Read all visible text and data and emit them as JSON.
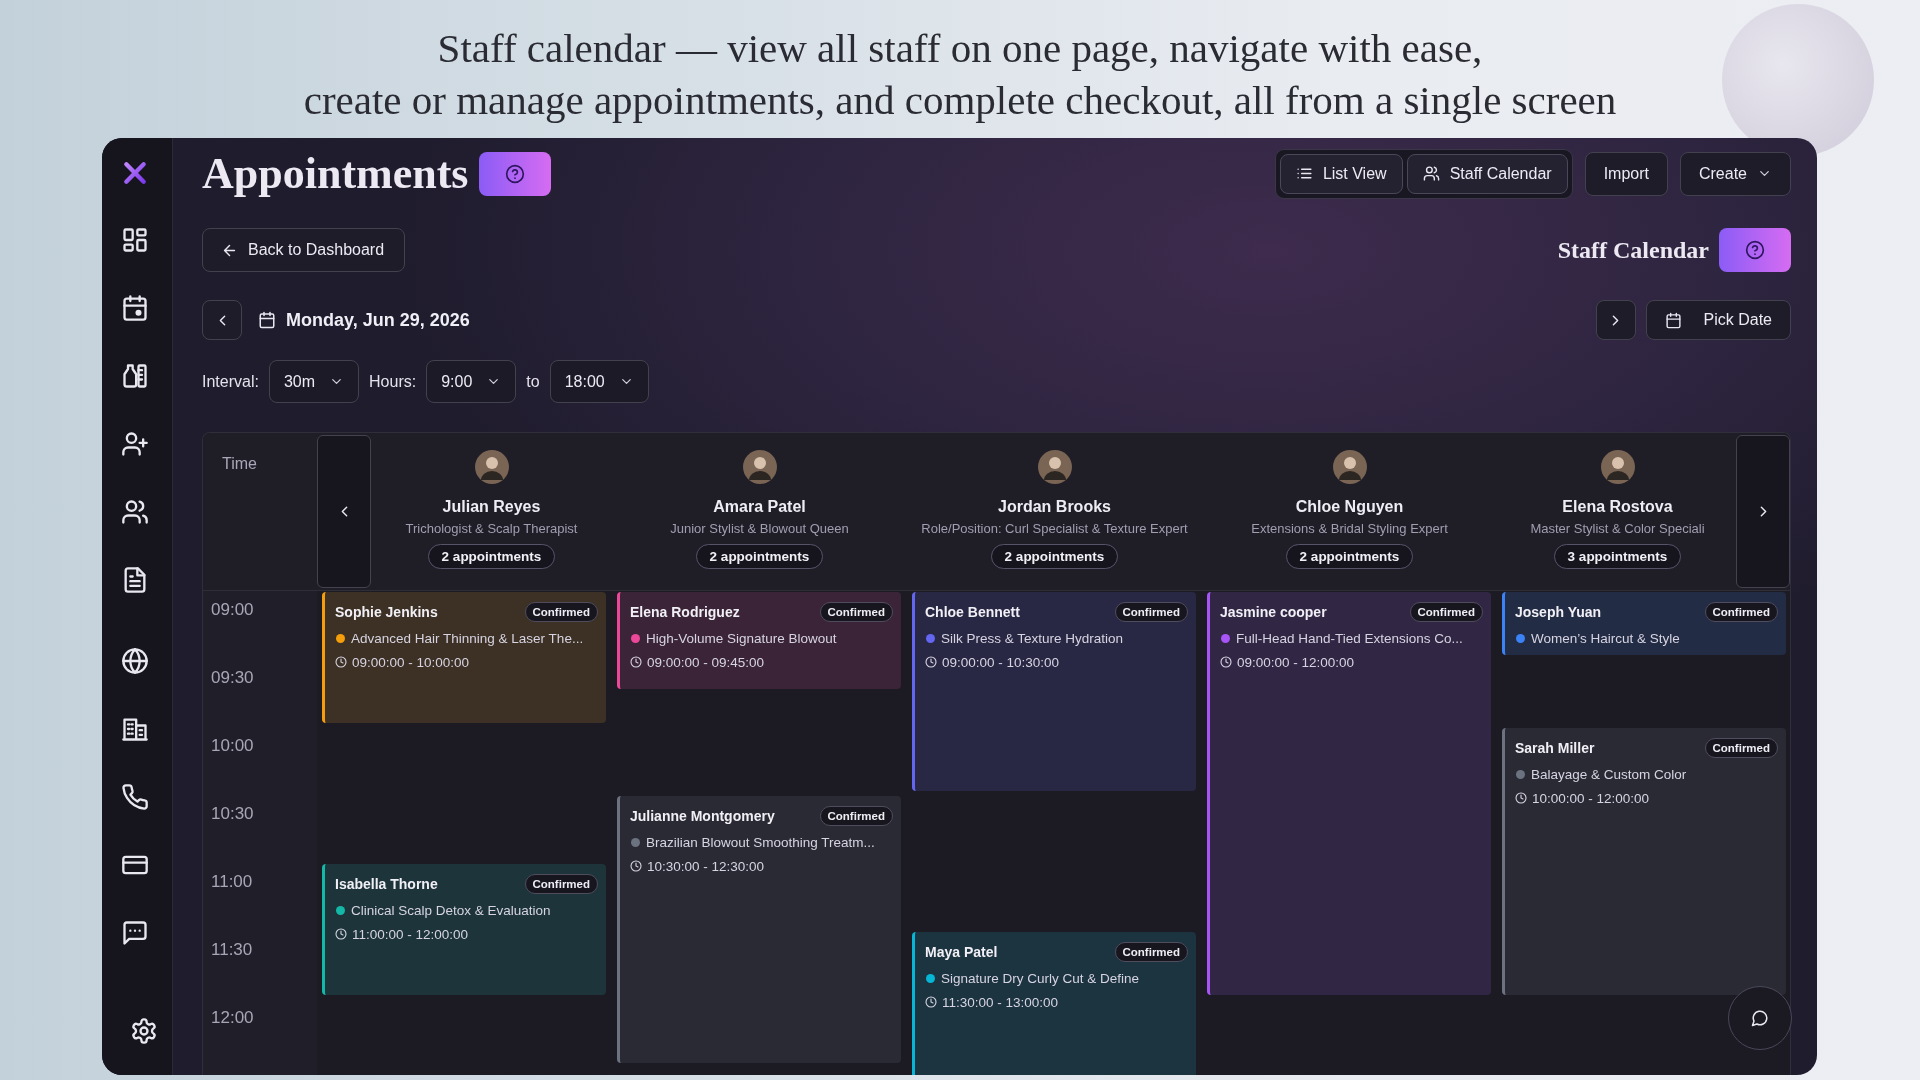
{
  "caption": [
    "Staff calendar — view all staff on one page, navigate with ease,",
    "create or manage appointments, and complete checkout, all from a single screen"
  ],
  "header": {
    "title": "Appointments",
    "view_buttons": [
      {
        "label": "List View",
        "kind": "list"
      },
      {
        "label": "Staff Calendar",
        "kind": "staff"
      }
    ],
    "actions": [
      {
        "label": "Import",
        "kind": "button"
      },
      {
        "label": "Create",
        "kind": "dropdown"
      }
    ]
  },
  "toolbar": {
    "back_button": "Back to Dashboard",
    "section_title": "Staff Calendar",
    "date": "Monday, Jun 29, 2026",
    "pick_date_button": "Pick Date"
  },
  "filters": {
    "interval_label": "Interval:",
    "interval": "30m",
    "hours_label": "Hours:",
    "hours_from": "9:00",
    "to_label": "to",
    "hours_to": "18:00"
  },
  "calendar": {
    "time_heading": "Time",
    "time_slots": [
      "09:00",
      "09:30",
      "10:00",
      "10:30",
      "11:00",
      "11:30",
      "12:00"
    ],
    "staff": [
      {
        "name": "Julian Reyes",
        "role": "Trichologist & Scalp Therapist",
        "count": "2 appointments",
        "appointments": [
          {
            "client": "Sophie Jenkins",
            "status": "Confirmed",
            "service": "Advanced Hair Thinning & Laser The...",
            "time": "09:00:00 - 10:00:00",
            "color": "#f59e0b"
          },
          {
            "client": "Isabella Thorne",
            "status": "Confirmed",
            "service": "Clinical Scalp Detox & Evaluation",
            "time": "11:00:00 - 12:00:00",
            "color": "#14b8a6"
          }
        ]
      },
      {
        "name": "Amara Patel",
        "role": "Junior Stylist & Blowout Queen",
        "count": "2 appointments",
        "appointments": [
          {
            "client": "Elena Rodriguez",
            "status": "Confirmed",
            "service": "High-Volume Signature Blowout",
            "time": "09:00:00 - 09:45:00",
            "color": "#ec4899"
          },
          {
            "client": "Julianne Montgomery",
            "status": "Confirmed",
            "service": "Brazilian Blowout Smoothing Treatm...",
            "time": "10:30:00 - 12:30:00",
            "color": "#6b7280"
          }
        ]
      },
      {
        "name": "Jordan Brooks",
        "role": "Role/Position: Curl Specialist & Texture Expert",
        "count": "2 appointments",
        "appointments": [
          {
            "client": "Chloe Bennett",
            "status": "Confirmed",
            "service": "Silk Press & Texture Hydration",
            "time": "09:00:00 - 10:30:00",
            "color": "#6366f1"
          },
          {
            "client": "Maya Patel",
            "status": "Confirmed",
            "service": "Signature Dry Curly Cut & Define",
            "time": "11:30:00 - 13:00:00",
            "color": "#06b6d4"
          }
        ]
      },
      {
        "name": "Chloe Nguyen",
        "role": "Extensions & Bridal Styling Expert",
        "count": "2 appointments",
        "appointments": [
          {
            "client": "Jasmine cooper",
            "status": "Confirmed",
            "service": "Full-Head Hand-Tied Extensions Co...",
            "time": "09:00:00 - 12:00:00",
            "color": "#a855f7"
          }
        ]
      },
      {
        "name": "Elena Rostova",
        "role": "Master Stylist & Color Speciali",
        "count": "3 appointments",
        "appointments": [
          {
            "client": "Joseph Yuan",
            "status": "Confirmed",
            "service": "Women’s Haircut & Style",
            "color": "#3b82f6"
          },
          {
            "client": "Sarah Miller",
            "status": "Confirmed",
            "service": "Balayage & Custom Color",
            "time": "10:00:00 - 12:00:00",
            "color": "#6b7280"
          }
        ]
      }
    ]
  }
}
